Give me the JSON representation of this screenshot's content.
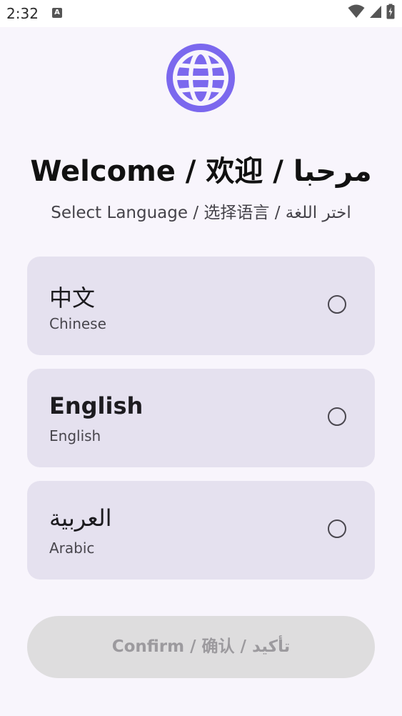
{
  "status_bar": {
    "time": "2:32",
    "notification_icon_letter": "A",
    "icons": [
      "wifi-icon",
      "cellular-signal-icon",
      "battery-charging-icon"
    ]
  },
  "header": {
    "icon": "globe-icon",
    "title": "Welcome / 欢迎 / مرحبا",
    "subtitle": "Select Language / 选择语言 / اختر اللغة"
  },
  "languages": [
    {
      "name": "中文",
      "english_name": "Chinese",
      "selected": false
    },
    {
      "name": "English",
      "english_name": "English",
      "selected": false
    },
    {
      "name": "العربية",
      "english_name": "Arabic",
      "selected": false
    }
  ],
  "confirm": {
    "label": "Confirm / 确认 / تأكيد",
    "enabled": false
  },
  "colors": {
    "accent": "#7b68ee",
    "background": "#f8f5fc",
    "card": "#e5e1ef",
    "button_disabled_bg": "#deddde",
    "button_disabled_text": "#9c9a9e"
  }
}
